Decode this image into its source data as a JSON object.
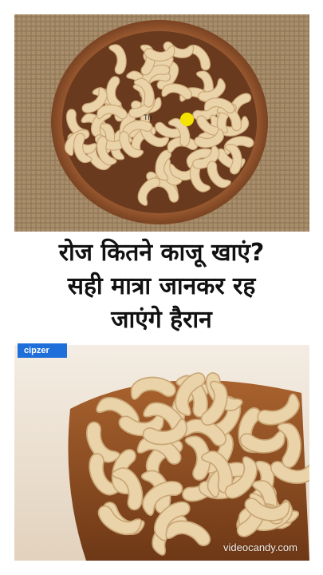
{
  "headline": {
    "line1": "रोज कितने काजू खाएं?",
    "line2": "सही मात्रा जानकर रह",
    "line3": "जाएंगे हैरान"
  },
  "badge": {
    "text": "cipzer"
  },
  "watermark": {
    "text": "videocandy.com"
  },
  "top_photo": {
    "th_mark": "Th"
  },
  "colors": {
    "background": "#ffffff",
    "headline": "#111111",
    "badge": "#1e6fd9",
    "cursor_dot": "#f4e300"
  }
}
